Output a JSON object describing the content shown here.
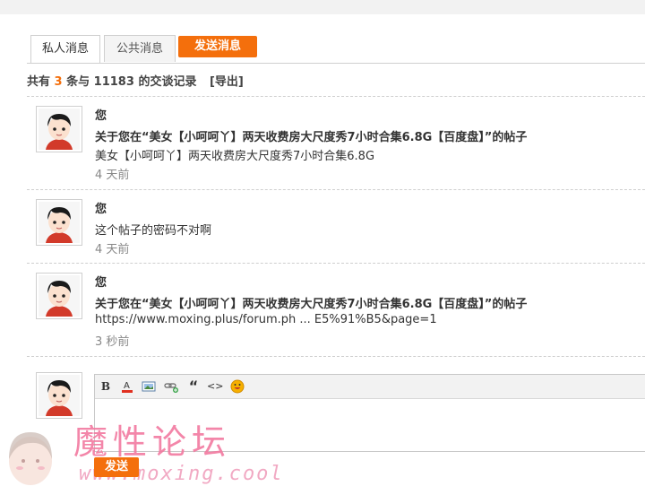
{
  "tabs": {
    "private": "私人消息",
    "public": "公共消息",
    "send": "发送消息"
  },
  "summary": {
    "prefix": "共有",
    "count": "3",
    "middle": "条与",
    "uid": "11183",
    "suffix": "的交谈记录",
    "export": "[导出]"
  },
  "messages": [
    {
      "author": "您",
      "line1": "关于您在“美女【小呵呵丫】两天收费房大尺度秀7小时合集6.8G【百度盘】”的帖子",
      "line2": "美女【小呵呵丫】两天收费房大尺度秀7小时合集6.8G",
      "time": "4 天前"
    },
    {
      "author": "您",
      "line1": "这个帖子的密码不对啊",
      "time": "4 天前"
    },
    {
      "author": "您",
      "line1": "关于您在“美女【小呵呵丫】两天收费房大尺度秀7小时合集6.8G【百度盘】”的帖子",
      "line2": "https://www.moxing.plus/forum.ph ... E5%91%B5&page=1",
      "time": "3 秒前"
    }
  ],
  "editor": {
    "toolbar": {
      "bold": "B",
      "quote": "“",
      "code": "<>"
    },
    "submit": "发送"
  },
  "watermark": {
    "title": "魔性论坛",
    "url": "www.moxing.cool"
  },
  "colors": {
    "accent": "#f46f0c",
    "watermark": "#f27aa0"
  }
}
